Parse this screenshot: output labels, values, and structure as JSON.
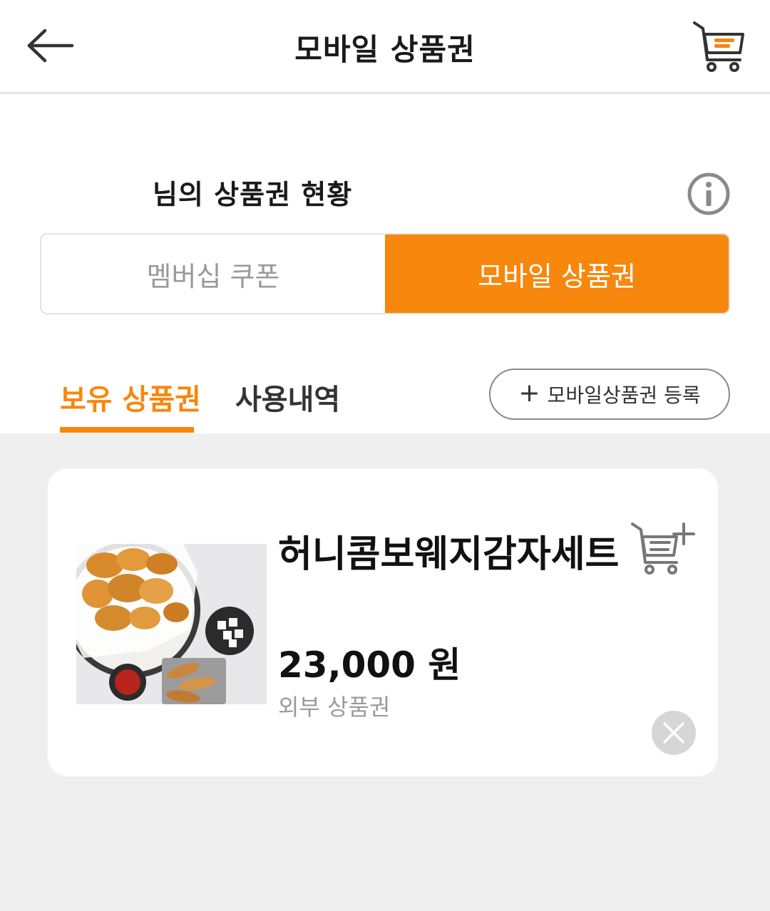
{
  "header": {
    "title": "모바일 상품권",
    "back_icon": "arrow-left-icon",
    "cart_icon": "cart-icon"
  },
  "status": {
    "title": "님의 상품권 현황",
    "info_icon": "info-icon"
  },
  "segment": {
    "items": [
      {
        "label": "멤버십 쿠폰",
        "active": false
      },
      {
        "label": "모바일 상품권",
        "active": true
      }
    ]
  },
  "subtabs": {
    "owned_label": "보유 상품권",
    "history_label": "사용내역",
    "register_label": "모바일상품권 등록",
    "register_icon": "plus-icon"
  },
  "vouchers": [
    {
      "name": "허니콤보웨지감자세트",
      "price": "23,000 원",
      "type": "외부 상품권",
      "image": "fried-chicken-set-photo",
      "add_icon": "add-to-cart-icon",
      "delete_icon": "close-icon"
    }
  ],
  "colors": {
    "accent": "#f7870d",
    "background_list": "#efefef",
    "muted_text": "#9a9a9a"
  }
}
